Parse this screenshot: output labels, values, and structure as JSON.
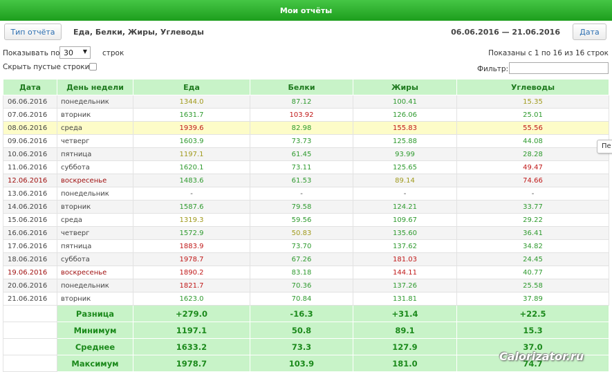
{
  "window": {
    "title": "Мои отчёты"
  },
  "toolbar": {
    "report_type_button": "Тип отчёта",
    "report_title": "Еда, Белки, Жиры, Углеводы",
    "date_range": "06.06.2016 — 21.06.2016",
    "date_button": "Дата"
  },
  "controls": {
    "show_label": "Показывать по",
    "rows_per_page": "30",
    "rows_label": "строк",
    "hide_empty_label": "Скрыть пустые строки:",
    "info": "Показаны с 1 по 16 из 16 строк",
    "filter_label": "Фильтр:",
    "filter_value": ""
  },
  "tooltip_fragment": "Пе",
  "table": {
    "headers": [
      "Дата",
      "День недели",
      "Еда",
      "Белки",
      "Жиры",
      "Углеводы"
    ],
    "rows": [
      {
        "date": "06.06.2016",
        "day": "понедельник",
        "food": "1344.0",
        "protein": "87.12",
        "fat": "100.41",
        "carbs": "15.35",
        "colors": [
          "o",
          "g",
          "g",
          "o"
        ]
      },
      {
        "date": "07.06.2016",
        "day": "вторник",
        "food": "1631.7",
        "protein": "103.92",
        "fat": "126.06",
        "carbs": "25.01",
        "colors": [
          "g",
          "r",
          "g",
          "g"
        ]
      },
      {
        "date": "08.06.2016",
        "day": "среда",
        "food": "1939.6",
        "protein": "82.98",
        "fat": "155.83",
        "carbs": "55.56",
        "colors": [
          "r",
          "g",
          "r",
          "r"
        ],
        "highlight": true
      },
      {
        "date": "09.06.2016",
        "day": "четверг",
        "food": "1603.9",
        "protein": "73.73",
        "fat": "125.88",
        "carbs": "44.08",
        "colors": [
          "g",
          "g",
          "g",
          "g"
        ]
      },
      {
        "date": "10.06.2016",
        "day": "пятница",
        "food": "1197.1",
        "protein": "61.45",
        "fat": "93.99",
        "carbs": "28.28",
        "colors": [
          "o",
          "g",
          "g",
          "g"
        ]
      },
      {
        "date": "11.06.2016",
        "day": "суббота",
        "food": "1620.1",
        "protein": "73.11",
        "fat": "125.65",
        "carbs": "49.47",
        "colors": [
          "g",
          "g",
          "g",
          "r"
        ]
      },
      {
        "date": "12.06.2016",
        "day": "воскресенье",
        "food": "1483.6",
        "protein": "61.53",
        "fat": "89.14",
        "carbs": "74.66",
        "colors": [
          "g",
          "g",
          "o",
          "r"
        ],
        "weekend": true
      },
      {
        "date": "13.06.2016",
        "day": "понедельник",
        "food": "-",
        "protein": "-",
        "fat": "-",
        "carbs": "-",
        "colors": [
          "n",
          "n",
          "n",
          "n"
        ]
      },
      {
        "date": "14.06.2016",
        "day": "вторник",
        "food": "1587.6",
        "protein": "79.58",
        "fat": "124.21",
        "carbs": "33.77",
        "colors": [
          "g",
          "g",
          "g",
          "g"
        ]
      },
      {
        "date": "15.06.2016",
        "day": "среда",
        "food": "1319.3",
        "protein": "59.56",
        "fat": "109.67",
        "carbs": "29.22",
        "colors": [
          "o",
          "g",
          "g",
          "g"
        ]
      },
      {
        "date": "16.06.2016",
        "day": "четверг",
        "food": "1572.9",
        "protein": "50.83",
        "fat": "135.60",
        "carbs": "36.41",
        "colors": [
          "g",
          "o",
          "g",
          "g"
        ]
      },
      {
        "date": "17.06.2016",
        "day": "пятница",
        "food": "1883.9",
        "protein": "73.70",
        "fat": "137.62",
        "carbs": "34.82",
        "colors": [
          "r",
          "g",
          "g",
          "g"
        ]
      },
      {
        "date": "18.06.2016",
        "day": "суббота",
        "food": "1978.7",
        "protein": "67.26",
        "fat": "181.03",
        "carbs": "24.45",
        "colors": [
          "r",
          "g",
          "r",
          "g"
        ]
      },
      {
        "date": "19.06.2016",
        "day": "воскресенье",
        "food": "1890.2",
        "protein": "83.18",
        "fat": "144.11",
        "carbs": "40.77",
        "colors": [
          "r",
          "g",
          "r",
          "g"
        ],
        "weekend": true
      },
      {
        "date": "20.06.2016",
        "day": "понедельник",
        "food": "1821.7",
        "protein": "70.36",
        "fat": "137.26",
        "carbs": "25.58",
        "colors": [
          "r",
          "g",
          "g",
          "g"
        ]
      },
      {
        "date": "21.06.2016",
        "day": "вторник",
        "food": "1623.0",
        "protein": "70.84",
        "fat": "131.81",
        "carbs": "37.89",
        "colors": [
          "g",
          "g",
          "g",
          "g"
        ]
      }
    ],
    "summary": [
      {
        "label": "Разница",
        "food": "+279.0",
        "protein": "-16.3",
        "fat": "+31.4",
        "carbs": "+22.5"
      },
      {
        "label": "Минимум",
        "food": "1197.1",
        "protein": "50.8",
        "fat": "89.1",
        "carbs": "15.3"
      },
      {
        "label": "Среднее",
        "food": "1633.2",
        "protein": "73.3",
        "fat": "127.9",
        "carbs": "37.0"
      },
      {
        "label": "Максимум",
        "food": "1978.7",
        "protein": "103.9",
        "fat": "181.0",
        "carbs": "74.7"
      }
    ]
  },
  "watermark": "Calorizator.ru"
}
